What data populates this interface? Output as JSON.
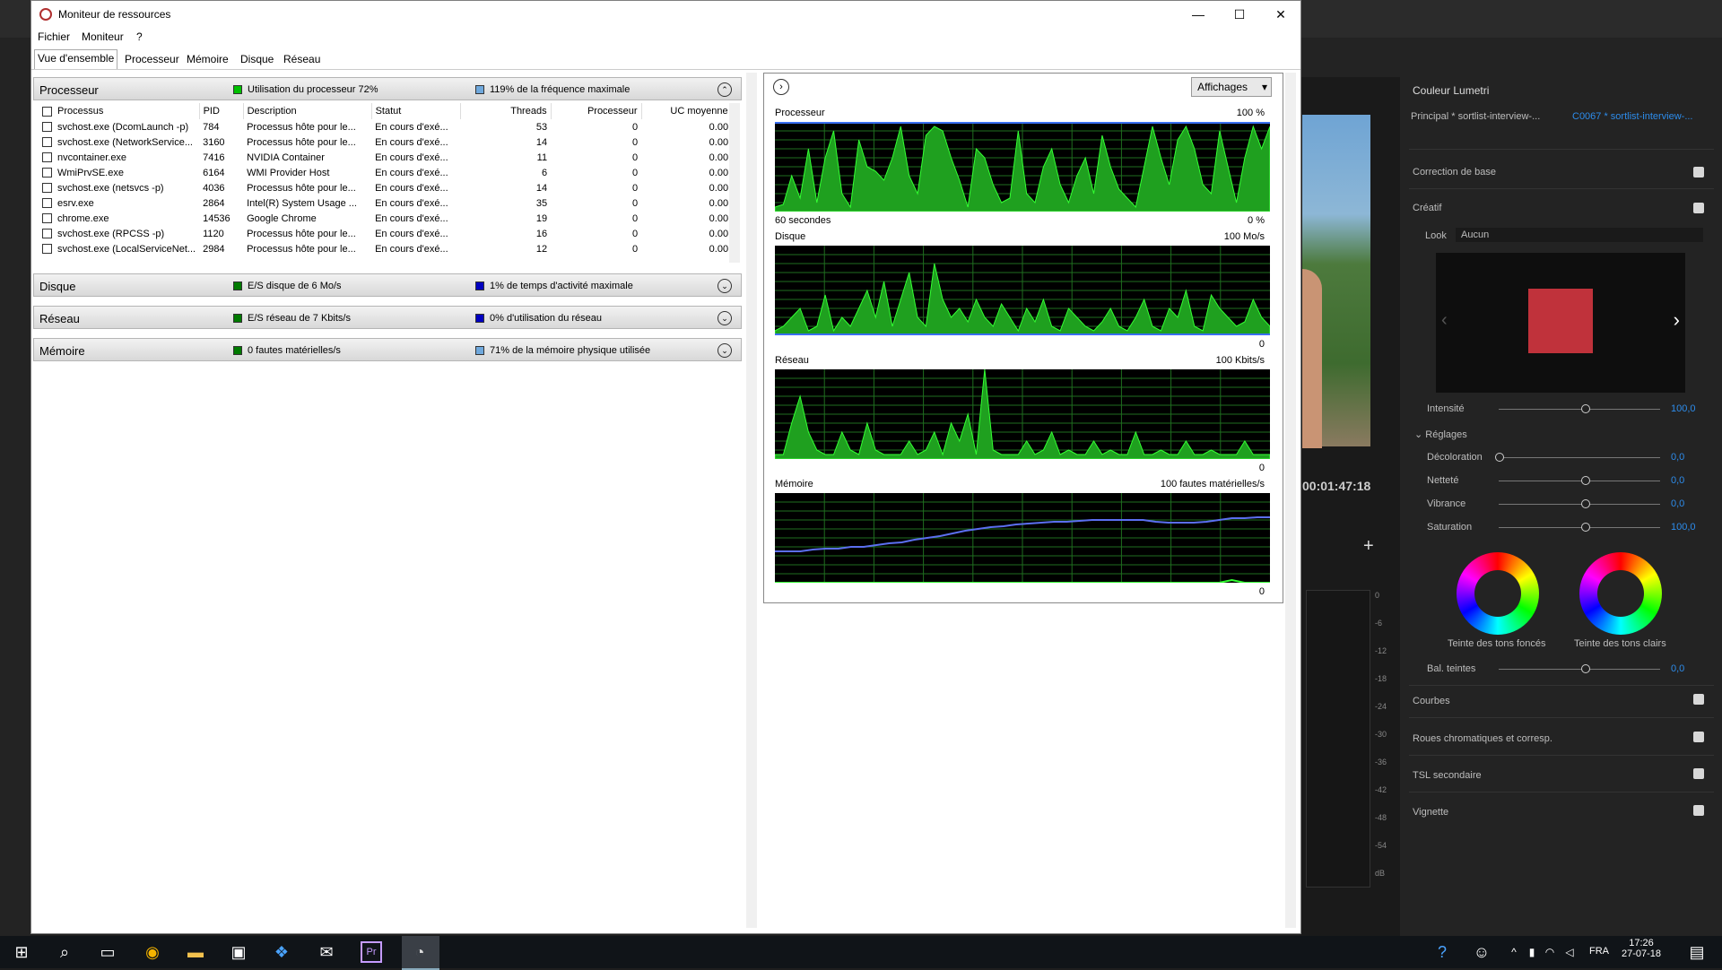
{
  "window": {
    "title": "Moniteur de ressources",
    "menu": [
      "Fichier",
      "Moniteur",
      "?"
    ],
    "tabs": [
      "Vue d'ensemble",
      "Processeur",
      "Mémoire",
      "Disque",
      "Réseau"
    ],
    "active_tab": 0
  },
  "processor_section": {
    "title": "Processeur",
    "stat1": "Utilisation du processeur 72%",
    "stat2": "119% de la fréquence maximale",
    "columns": [
      "Processus",
      "PID",
      "Description",
      "Statut",
      "Threads",
      "Processeur",
      "UC moyenne"
    ],
    "rows": [
      [
        "svchost.exe (DcomLaunch -p)",
        "784",
        "Processus hôte pour le...",
        "En cours d'exé...",
        "53",
        "0",
        "0.00"
      ],
      [
        "svchost.exe (NetworkService...",
        "3160",
        "Processus hôte pour le...",
        "En cours d'exé...",
        "14",
        "0",
        "0.00"
      ],
      [
        "nvcontainer.exe",
        "7416",
        "NVIDIA Container",
        "En cours d'exé...",
        "11",
        "0",
        "0.00"
      ],
      [
        "WmiPrvSE.exe",
        "6164",
        "WMI Provider Host",
        "En cours d'exé...",
        "6",
        "0",
        "0.00"
      ],
      [
        "svchost.exe (netsvcs -p)",
        "4036",
        "Processus hôte pour le...",
        "En cours d'exé...",
        "14",
        "0",
        "0.00"
      ],
      [
        "esrv.exe",
        "2864",
        "Intel(R) System Usage ...",
        "En cours d'exé...",
        "35",
        "0",
        "0.00"
      ],
      [
        "chrome.exe",
        "14536",
        "Google Chrome",
        "En cours d'exé...",
        "19",
        "0",
        "0.00"
      ],
      [
        "svchost.exe (RPCSS -p)",
        "1120",
        "Processus hôte pour le...",
        "En cours d'exé...",
        "16",
        "0",
        "0.00"
      ],
      [
        "svchost.exe (LocalServiceNet...",
        "2984",
        "Processus hôte pour le...",
        "En cours d'exé...",
        "12",
        "0",
        "0.00"
      ]
    ]
  },
  "disk_section": {
    "title": "Disque",
    "stat1": "E/S disque de 6 Mo/s",
    "stat2": "1% de temps d'activité maximale"
  },
  "network_section": {
    "title": "Réseau",
    "stat1": "E/S réseau de 7 Kbits/s",
    "stat2": "0% d'utilisation du réseau"
  },
  "memory_section": {
    "title": "Mémoire",
    "stat1": "0 fautes matérielles/s",
    "stat2": "71% de la mémoire physique utilisée"
  },
  "graphs": {
    "view_button": "Affichages",
    "processor": {
      "title": "Processeur",
      "max": "100 %",
      "time_label": "60 secondes",
      "min": "0 %"
    },
    "disk": {
      "title": "Disque",
      "max": "100 Mo/s",
      "min": "0"
    },
    "network": {
      "title": "Réseau",
      "max": "100 Kbits/s",
      "min": "0"
    },
    "memory": {
      "title": "Mémoire",
      "max": "100 fautes matérielles/s",
      "min": "0"
    }
  },
  "chart_data": [
    {
      "type": "area",
      "title": "Processeur",
      "ylim": [
        0,
        100
      ],
      "values": [
        5,
        8,
        40,
        15,
        70,
        10,
        60,
        90,
        20,
        5,
        80,
        50,
        45,
        35,
        60,
        95,
        40,
        20,
        85,
        95,
        90,
        60,
        35,
        5,
        70,
        60,
        30,
        10,
        15,
        90,
        20,
        10,
        50,
        70,
        30,
        10,
        40,
        60,
        20,
        85,
        50,
        25,
        15,
        5,
        50,
        95,
        60,
        30,
        80,
        95,
        70,
        30,
        20,
        90,
        50,
        10,
        60,
        95,
        70,
        95
      ]
    },
    {
      "type": "area",
      "title": "Disque",
      "ylim": [
        0,
        100
      ],
      "values": [
        5,
        10,
        20,
        30,
        5,
        10,
        45,
        5,
        20,
        10,
        30,
        50,
        20,
        60,
        10,
        40,
        70,
        20,
        10,
        80,
        40,
        20,
        30,
        15,
        40,
        20,
        10,
        35,
        20,
        5,
        30,
        15,
        40,
        10,
        5,
        30,
        20,
        10,
        5,
        15,
        30,
        10,
        5,
        20,
        40,
        10,
        5,
        30,
        20,
        50,
        10,
        5,
        45,
        30,
        20,
        10,
        15,
        40,
        20,
        10
      ]
    },
    {
      "type": "area",
      "title": "Réseau",
      "ylim": [
        0,
        100
      ],
      "values": [
        5,
        5,
        40,
        70,
        30,
        10,
        5,
        5,
        30,
        10,
        5,
        40,
        10,
        5,
        5,
        5,
        20,
        5,
        10,
        30,
        5,
        40,
        20,
        50,
        5,
        100,
        10,
        5,
        5,
        5,
        20,
        5,
        10,
        30,
        5,
        10,
        5,
        5,
        20,
        5,
        10,
        5,
        5,
        30,
        5,
        5,
        10,
        5,
        5,
        20,
        5,
        5,
        10,
        5,
        5,
        5,
        20,
        5,
        5,
        5
      ]
    },
    {
      "type": "line",
      "title": "Mémoire",
      "ylim": [
        0,
        100
      ],
      "series": [
        {
          "values": [
            35,
            35,
            35,
            37,
            38,
            38,
            40,
            40,
            42,
            44,
            45,
            48,
            50,
            52,
            55,
            58,
            60,
            62,
            63,
            65,
            66,
            67,
            68,
            68,
            69,
            70,
            70,
            70,
            70,
            70,
            68,
            67,
            67,
            67,
            68,
            70,
            72,
            72,
            73,
            73
          ]
        },
        {
          "values": [
            0,
            0,
            0,
            0,
            0,
            0,
            0,
            0,
            0,
            0,
            0,
            0,
            0,
            0,
            0,
            0,
            0,
            0,
            0,
            0,
            0,
            0,
            0,
            0,
            0,
            0,
            0,
            0,
            0,
            0,
            0,
            0,
            0,
            0,
            0,
            0,
            3,
            0,
            0,
            0
          ]
        }
      ]
    }
  ],
  "premiere": {
    "timecode": "00:01:47:18",
    "lumetri_title": "Couleur Lumetri",
    "principal": "Principal * sortlist-interview-...",
    "clip": "C0067 * sortlist-interview-...",
    "sections": [
      "Correction de base",
      "Créatif",
      "Courbes",
      "Roues chromatiques et corresp.",
      "TSL secondaire",
      "Vignette"
    ],
    "look_label": "Look",
    "look_value": "Aucun",
    "intensite": {
      "label": "Intensité",
      "value": "100,0"
    },
    "reglages": "Réglages",
    "adjust": [
      {
        "label": "Décoloration",
        "value": "0,0"
      },
      {
        "label": "Netteté",
        "value": "0,0"
      },
      {
        "label": "Vibrance",
        "value": "0,0"
      },
      {
        "label": "Saturation",
        "value": "100,0"
      }
    ],
    "wheel_dark": "Teinte des tons foncés",
    "wheel_light": "Teinte des tons clairs",
    "bal_teintes": {
      "label": "Bal. teintes",
      "value": "0,0"
    },
    "meter_db": [
      "0",
      "-6",
      "-12",
      "-18",
      "-24",
      "-30",
      "-36",
      "-42",
      "-48",
      "-54",
      "dB"
    ]
  },
  "taskbar": {
    "lang": "FRA",
    "time": "17:26",
    "date": "27-07-18"
  }
}
